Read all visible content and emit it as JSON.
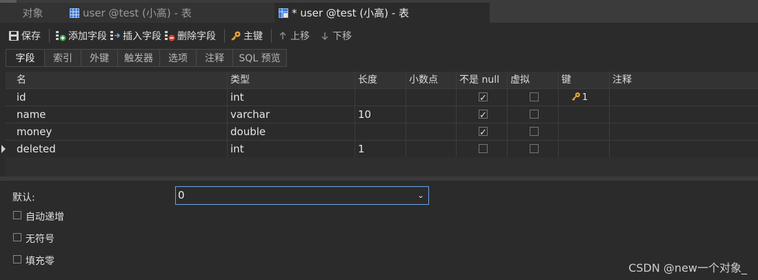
{
  "tabs": [
    {
      "label": "对象"
    },
    {
      "label": "user @test (小高) - 表"
    },
    {
      "label": "* user @test (小高) - 表"
    }
  ],
  "toolbar": {
    "save": "保存",
    "add_field": "添加字段",
    "insert_field": "插入字段",
    "delete_field": "删除字段",
    "primary_key": "主键",
    "move_up": "上移",
    "move_down": "下移"
  },
  "subtabs": [
    "字段",
    "索引",
    "外键",
    "触发器",
    "选项",
    "注释",
    "SQL 预览"
  ],
  "grid": {
    "headers": [
      "名",
      "类型",
      "长度",
      "小数点",
      "不是 null",
      "虚拟",
      "键",
      "注释"
    ],
    "rows": [
      {
        "name": "id",
        "type": "int",
        "length": "",
        "decimals": "",
        "not_null": true,
        "virtual": false,
        "key": "1",
        "comment": ""
      },
      {
        "name": "name",
        "type": "varchar",
        "length": "10",
        "decimals": "",
        "not_null": true,
        "virtual": false,
        "key": "",
        "comment": ""
      },
      {
        "name": "money",
        "type": "double",
        "length": "",
        "decimals": "",
        "not_null": true,
        "virtual": false,
        "key": "",
        "comment": ""
      },
      {
        "name": "deleted",
        "type": "int",
        "length": "1",
        "decimals": "",
        "not_null": false,
        "virtual": false,
        "key": "",
        "comment": ""
      }
    ]
  },
  "props": {
    "default_label": "默认:",
    "default_value": "0",
    "auto_increment": "自动递增",
    "unsigned": "无符号",
    "zerofill": "填充零"
  },
  "watermark": "CSDN @new一个对象_"
}
